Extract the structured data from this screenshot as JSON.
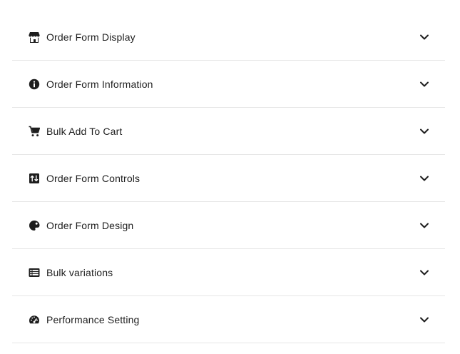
{
  "panels": [
    {
      "label": "Order Form Display",
      "icon": "store-icon"
    },
    {
      "label": "Order Form Information",
      "icon": "info-icon"
    },
    {
      "label": "Bulk Add To Cart",
      "icon": "cart-icon"
    },
    {
      "label": "Order Form Controls",
      "icon": "sort-controls-icon"
    },
    {
      "label": "Order Form Design",
      "icon": "palette-icon"
    },
    {
      "label": "Bulk variations",
      "icon": "list-card-icon"
    },
    {
      "label": "Performance Setting",
      "icon": "gauge-icon"
    }
  ],
  "colors": {
    "text": "#1e1e1e",
    "divider": "#e6e6e6",
    "background": "#ffffff"
  }
}
